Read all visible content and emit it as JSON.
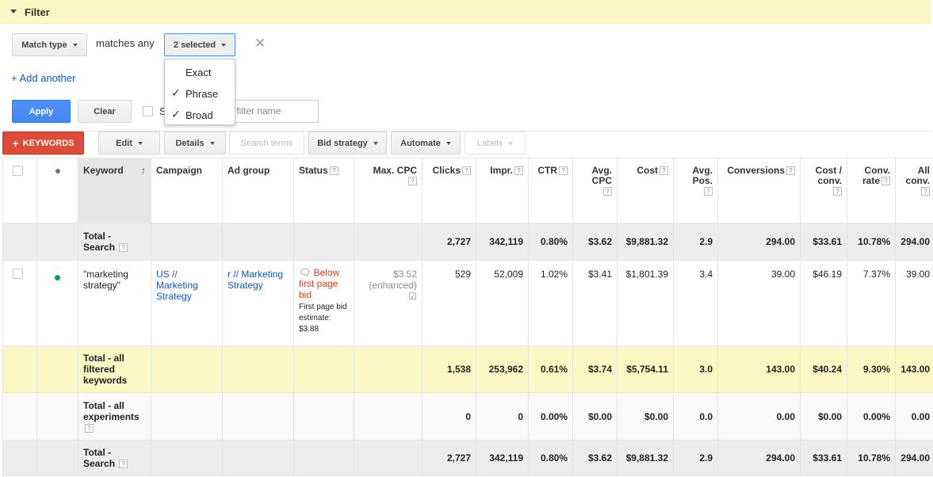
{
  "filter": {
    "title": "Filter",
    "match_type_label": "Match type",
    "matches_text": "matches any",
    "selected_label": "2 selected",
    "close_glyph": "✕",
    "add_another": "+ Add another",
    "apply_label": "Apply",
    "clear_label": "Clear",
    "save_label_partial": "S",
    "filter_name_placeholder": "r filter name",
    "dropdown_options": [
      {
        "label": "Exact",
        "checked": false
      },
      {
        "label": "Phrase",
        "checked": true
      },
      {
        "label": "Broad",
        "checked": true
      }
    ]
  },
  "toolbar": {
    "keywords_label": "KEYWORDS",
    "edit_label": "Edit",
    "details_label": "Details",
    "search_terms_label": "Search terms",
    "bid_strategy_label": "Bid strategy",
    "automate_label": "Automate",
    "labels_label": "Labels"
  },
  "table": {
    "headers": {
      "keyword": "Keyword",
      "campaign": "Campaign",
      "ad_group": "Ad group",
      "status": "Status",
      "max_cpc": "Max. CPC",
      "clicks": "Clicks",
      "impr": "Impr.",
      "ctr": "CTR",
      "avg_cpc_1": "Avg.",
      "avg_cpc_2": "CPC",
      "cost": "Cost",
      "avg_pos_1": "Avg.",
      "avg_pos_2": "Pos.",
      "conversions": "Conversions",
      "cost_conv_1": "Cost /",
      "cost_conv_2": "conv.",
      "conv_rate_1": "Conv.",
      "conv_rate_2": "rate",
      "all_conv_1": "All",
      "all_conv_2": "conv."
    },
    "help": "?",
    "sort_arrow": "↑",
    "total_search_top": {
      "label_1": "Total -",
      "label_2": "Search",
      "clicks": "2,727",
      "impr": "342,119",
      "ctr": "0.80%",
      "avg_cpc": "$3.62",
      "cost": "$9,881.32",
      "avg_pos": "2.9",
      "conversions": "294.00",
      "cost_conv": "$33.61",
      "conv_rate": "10.78%",
      "all_conv": "294.00"
    },
    "row": {
      "keyword": "\"marketing strategy\"",
      "campaign": "US // Marketing Strategy",
      "ad_group": "r // Marketing Strategy",
      "status_icon": "🗨",
      "status_main": "Below first page bid",
      "status_sub": "First page bid estimate: $3.88",
      "max_cpc": "$3.52",
      "max_cpc_note": "(enhanced)",
      "max_cpc_icon": "☑",
      "clicks": "529",
      "impr": "52,009",
      "ctr": "1.02%",
      "avg_cpc": "$3.41",
      "cost": "$1,801.39",
      "avg_pos": "3.4",
      "conversions": "39.00",
      "cost_conv": "$46.19",
      "conv_rate": "7.37%",
      "all_conv": "39.00"
    },
    "total_filtered": {
      "label": "Total - all filtered keywords",
      "clicks": "1,538",
      "impr": "253,962",
      "ctr": "0.61%",
      "avg_cpc": "$3.74",
      "cost": "$5,754.11",
      "avg_pos": "3.0",
      "conversions": "143.00",
      "cost_conv": "$40.24",
      "conv_rate": "9.30%",
      "all_conv": "143.00"
    },
    "total_experiments": {
      "label": "Total - all experiments",
      "clicks": "0",
      "impr": "0",
      "ctr": "0.00%",
      "avg_cpc": "$0.00",
      "cost": "$0.00",
      "avg_pos": "0.0",
      "conversions": "0.00",
      "cost_conv": "$0.00",
      "conv_rate": "0.00%",
      "all_conv": "0.00"
    },
    "total_search_bottom": {
      "label_1": "Total -",
      "label_2": "Search",
      "clicks": "2,727",
      "impr": "342,119",
      "ctr": "0.80%",
      "avg_cpc": "$3.62",
      "cost": "$9,881.32",
      "avg_pos": "2.9",
      "conversions": "294.00",
      "cost_conv": "$33.61",
      "conv_rate": "10.78%",
      "all_conv": "294.00"
    }
  },
  "colors": {
    "filter_bg": "#fcf6c5",
    "apply_blue": "#4d90fe",
    "keywords_red": "#dd4b39",
    "link_blue": "#1155cc",
    "status_red": "#e3391c",
    "enabled_green": "#0e9d58"
  }
}
